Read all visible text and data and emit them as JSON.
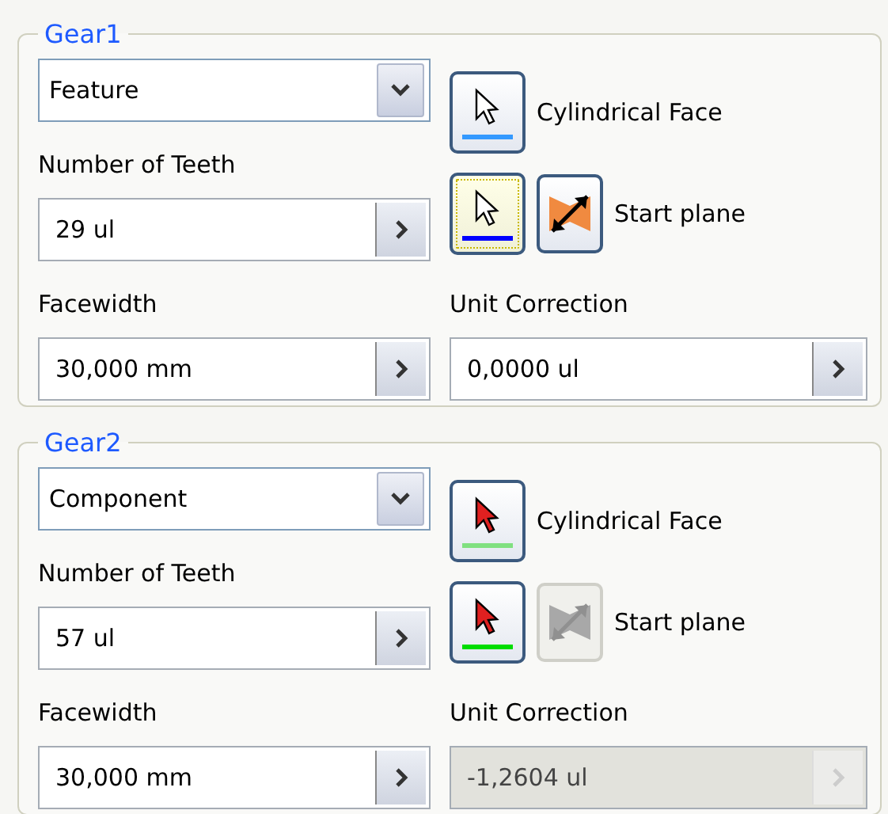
{
  "groups": [
    {
      "title": "Gear1",
      "type_dropdown": {
        "value": "Feature"
      },
      "cylindrical_face": {
        "label": "Cylindrical Face",
        "needs_selection": false,
        "focused": false,
        "color": "#3399ff"
      },
      "start_plane": {
        "label": "Start plane",
        "needs_selection": false,
        "focused": true,
        "color": "#0000ff",
        "flip_disabled": false
      },
      "number_of_teeth": {
        "label": "Number of Teeth",
        "value": "29 ul",
        "disabled": false
      },
      "facewidth": {
        "label": "Facewidth",
        "value": "30,000 mm",
        "disabled": false
      },
      "unit_correction": {
        "label": "Unit Correction",
        "value": "0,0000 ul",
        "disabled": false
      }
    },
    {
      "title": "Gear2",
      "type_dropdown": {
        "value": "Component"
      },
      "cylindrical_face": {
        "label": "Cylindrical Face",
        "needs_selection": true,
        "focused": false,
        "color": "#80e080"
      },
      "start_plane": {
        "label": "Start plane",
        "needs_selection": true,
        "focused": false,
        "color": "#00dd00",
        "flip_disabled": true
      },
      "number_of_teeth": {
        "label": "Number of Teeth",
        "value": "57 ul",
        "disabled": false
      },
      "facewidth": {
        "label": "Facewidth",
        "value": "30,000 mm",
        "disabled": false
      },
      "unit_correction": {
        "label": "Unit Correction",
        "value": "-1,2604 ul",
        "disabled": true
      }
    }
  ]
}
